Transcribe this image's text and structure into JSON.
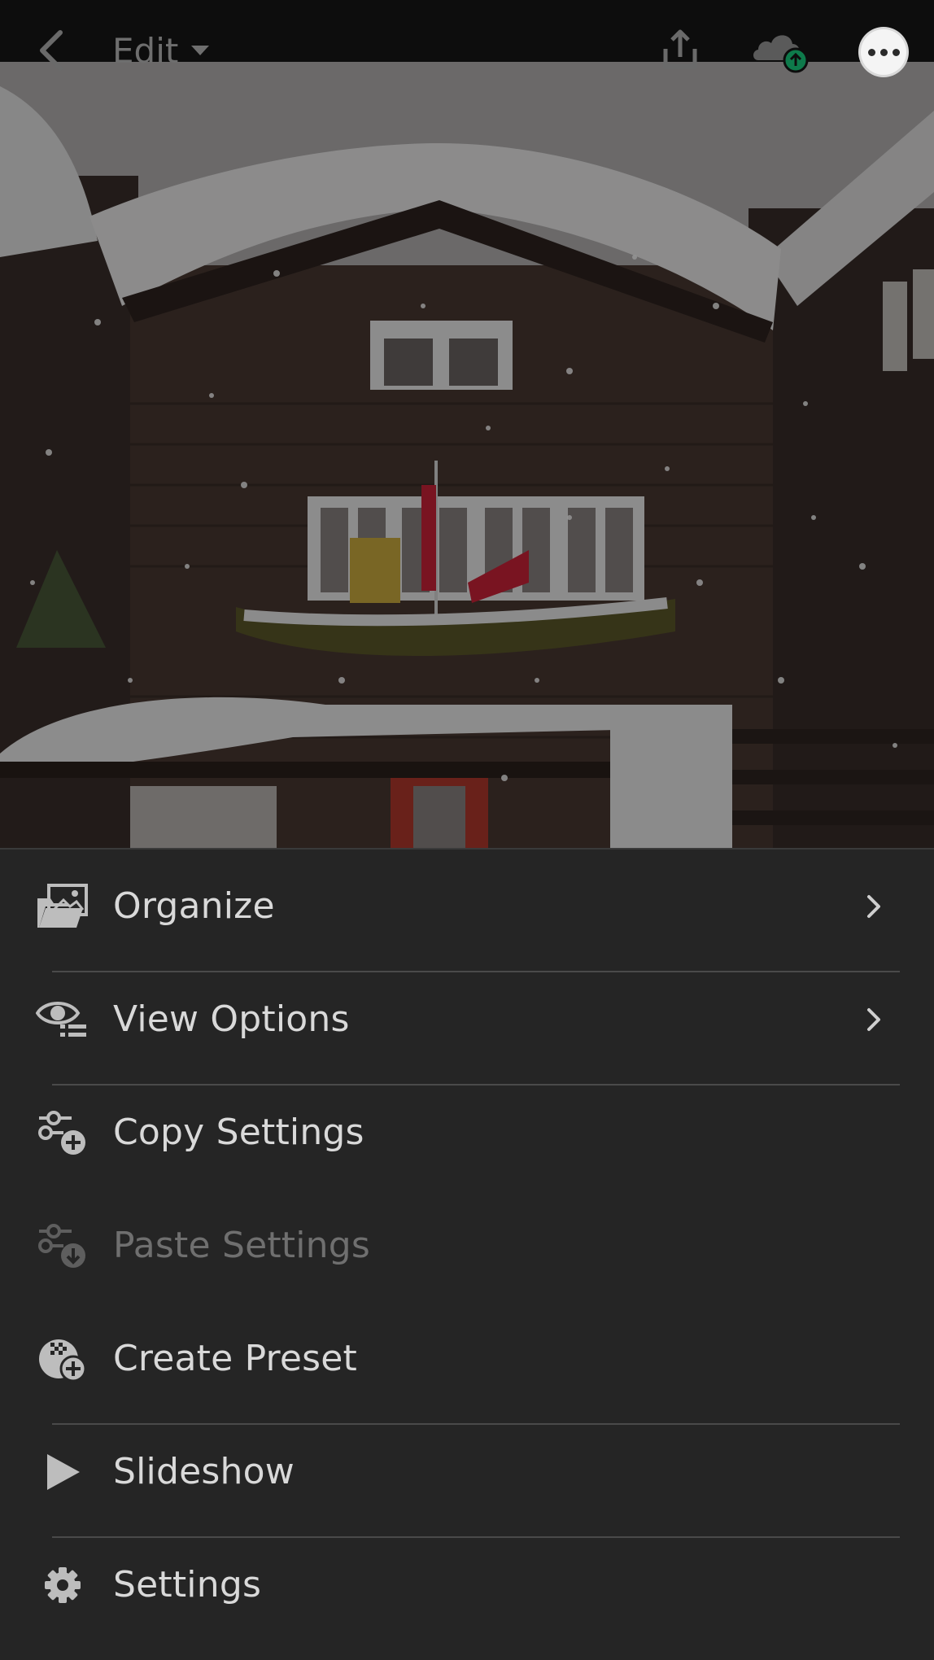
{
  "topbar": {
    "mode_label": "Edit",
    "icons": {
      "back": "chevron-left-icon",
      "mode_dropdown": "caret-down-icon",
      "share": "share-icon",
      "cloud": "cloud-sync-icon",
      "more": "more-options-icon"
    }
  },
  "photo": {
    "description_icon": "photo-canvas"
  },
  "menu": {
    "items": [
      {
        "label": "Organize",
        "icon": "organize-icon",
        "has_submenu": true,
        "enabled": true
      },
      {
        "label": "View Options",
        "icon": "view-options-icon",
        "has_submenu": true,
        "enabled": true
      },
      {
        "label": "Copy Settings",
        "icon": "copy-settings-icon",
        "has_submenu": false,
        "enabled": true
      },
      {
        "label": "Paste Settings",
        "icon": "paste-settings-icon",
        "has_submenu": false,
        "enabled": false
      },
      {
        "label": "Create Preset",
        "icon": "create-preset-icon",
        "has_submenu": false,
        "enabled": true
      },
      {
        "label": "Slideshow",
        "icon": "play-icon",
        "has_submenu": false,
        "enabled": true
      },
      {
        "label": "Settings",
        "icon": "gear-icon",
        "has_submenu": false,
        "enabled": true
      }
    ]
  },
  "colors": {
    "sheet_bg": "#252525",
    "text": "#d9d9d9",
    "text_disabled": "#6f6f6f",
    "sync_badge": "#0e7a4b"
  }
}
